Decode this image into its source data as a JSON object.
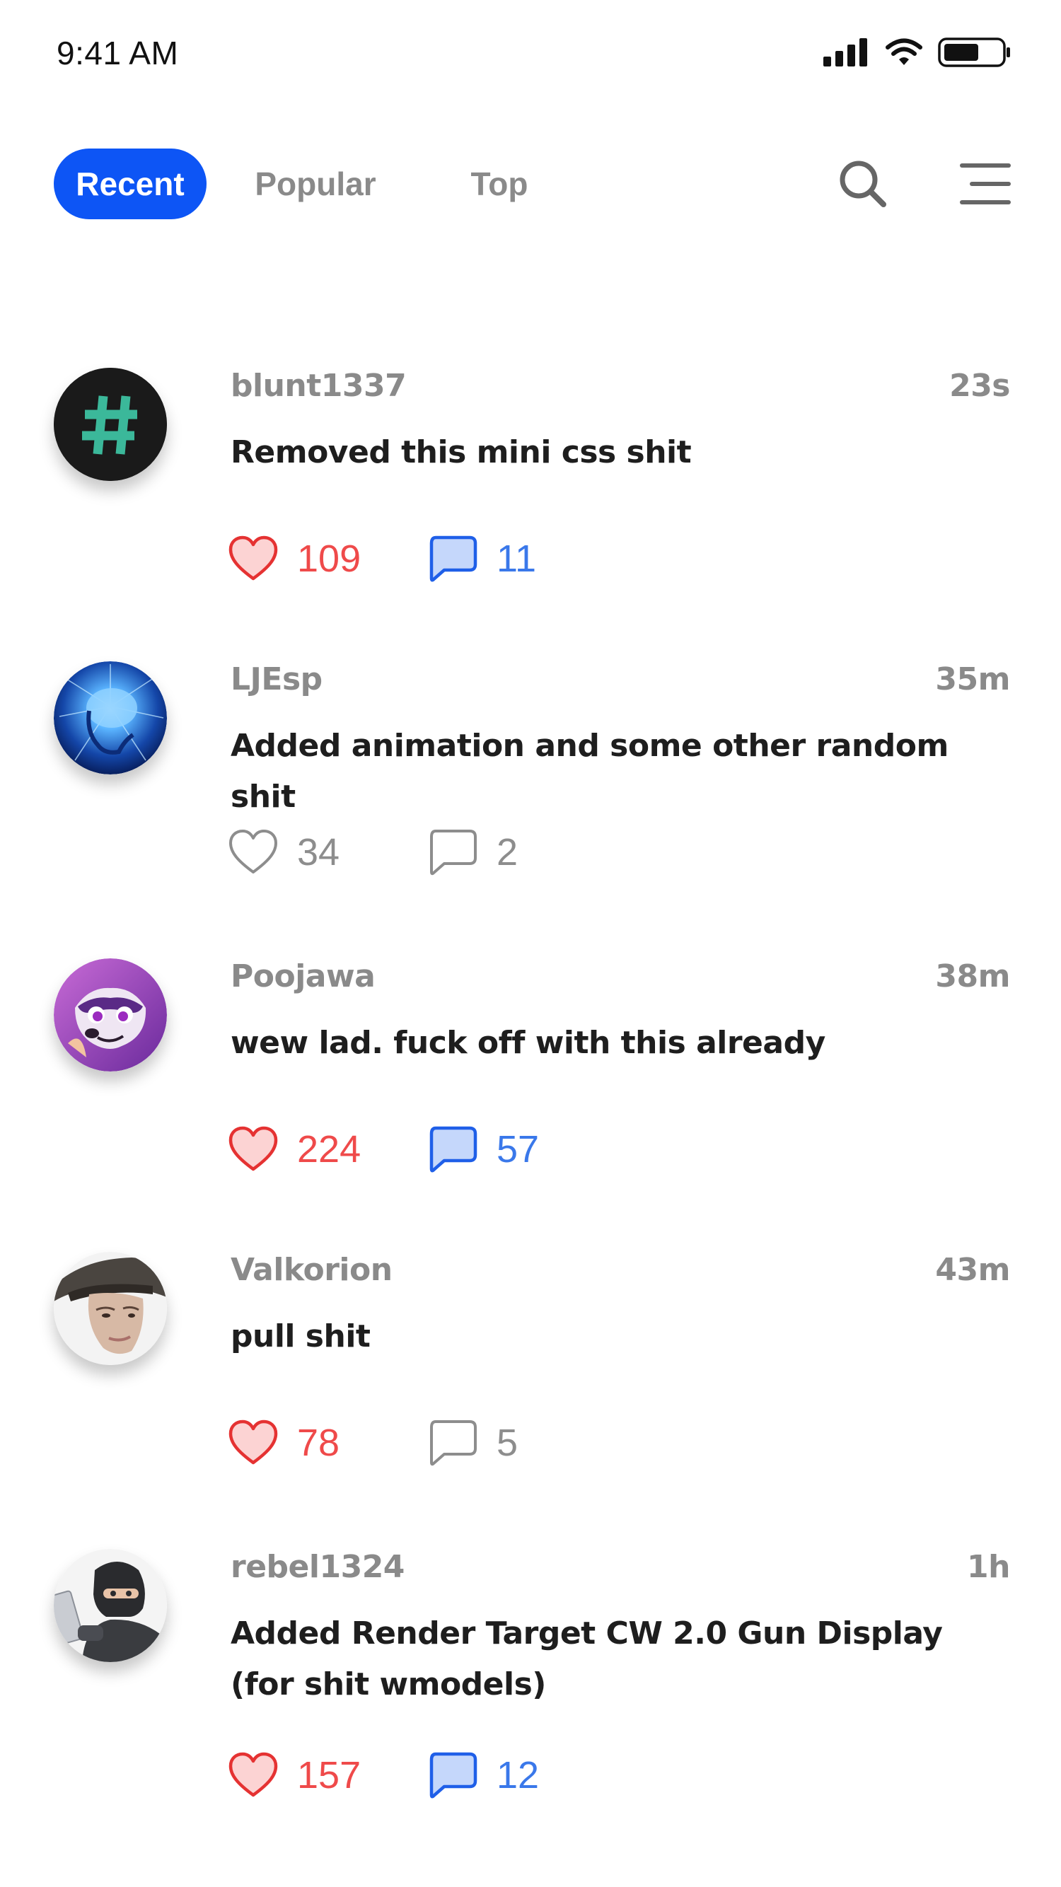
{
  "status_bar": {
    "time": "9:41 AM"
  },
  "nav": {
    "tabs": [
      {
        "label": "Recent",
        "active": true
      },
      {
        "label": "Popular",
        "active": false
      },
      {
        "label": "Top",
        "active": false
      }
    ],
    "icons": [
      "search-icon",
      "menu-icon"
    ],
    "accent_color": "#0d55f5"
  },
  "posts": [
    {
      "username": "blunt1337",
      "time": "23s",
      "message": "Removed this mini css shit",
      "likes": "109",
      "comments": "11",
      "liked": true,
      "commented": true,
      "avatar": "hashtag-avatar"
    },
    {
      "username": "LJEsp",
      "time": "35m",
      "message": "Added animation and some other random shit",
      "likes": "34",
      "comments": "2",
      "liked": false,
      "commented": false,
      "avatar": "brain-avatar"
    },
    {
      "username": "Poojawa",
      "time": "38m",
      "message": "wew lad. fuck off with this already",
      "likes": "224",
      "comments": "57",
      "liked": true,
      "commented": true,
      "avatar": "fox-avatar"
    },
    {
      "username": "Valkorion",
      "time": "43m",
      "message": "pull shit",
      "likes": "78",
      "comments": "5",
      "liked": true,
      "commented": false,
      "avatar": "portrait-avatar"
    },
    {
      "username": "rebel1324",
      "time": "1h",
      "message_lines": [
        "Added Render Target CW 2.0 Gun Display",
        "(for shit wmodels)"
      ],
      "likes": "157",
      "comments": "12",
      "liked": true,
      "commented": true,
      "avatar": "masked-avatar"
    }
  ],
  "colors": {
    "like_active": "#ef4a4a",
    "comment_active": "#3a78ea",
    "inactive": "#8d8d8d"
  }
}
